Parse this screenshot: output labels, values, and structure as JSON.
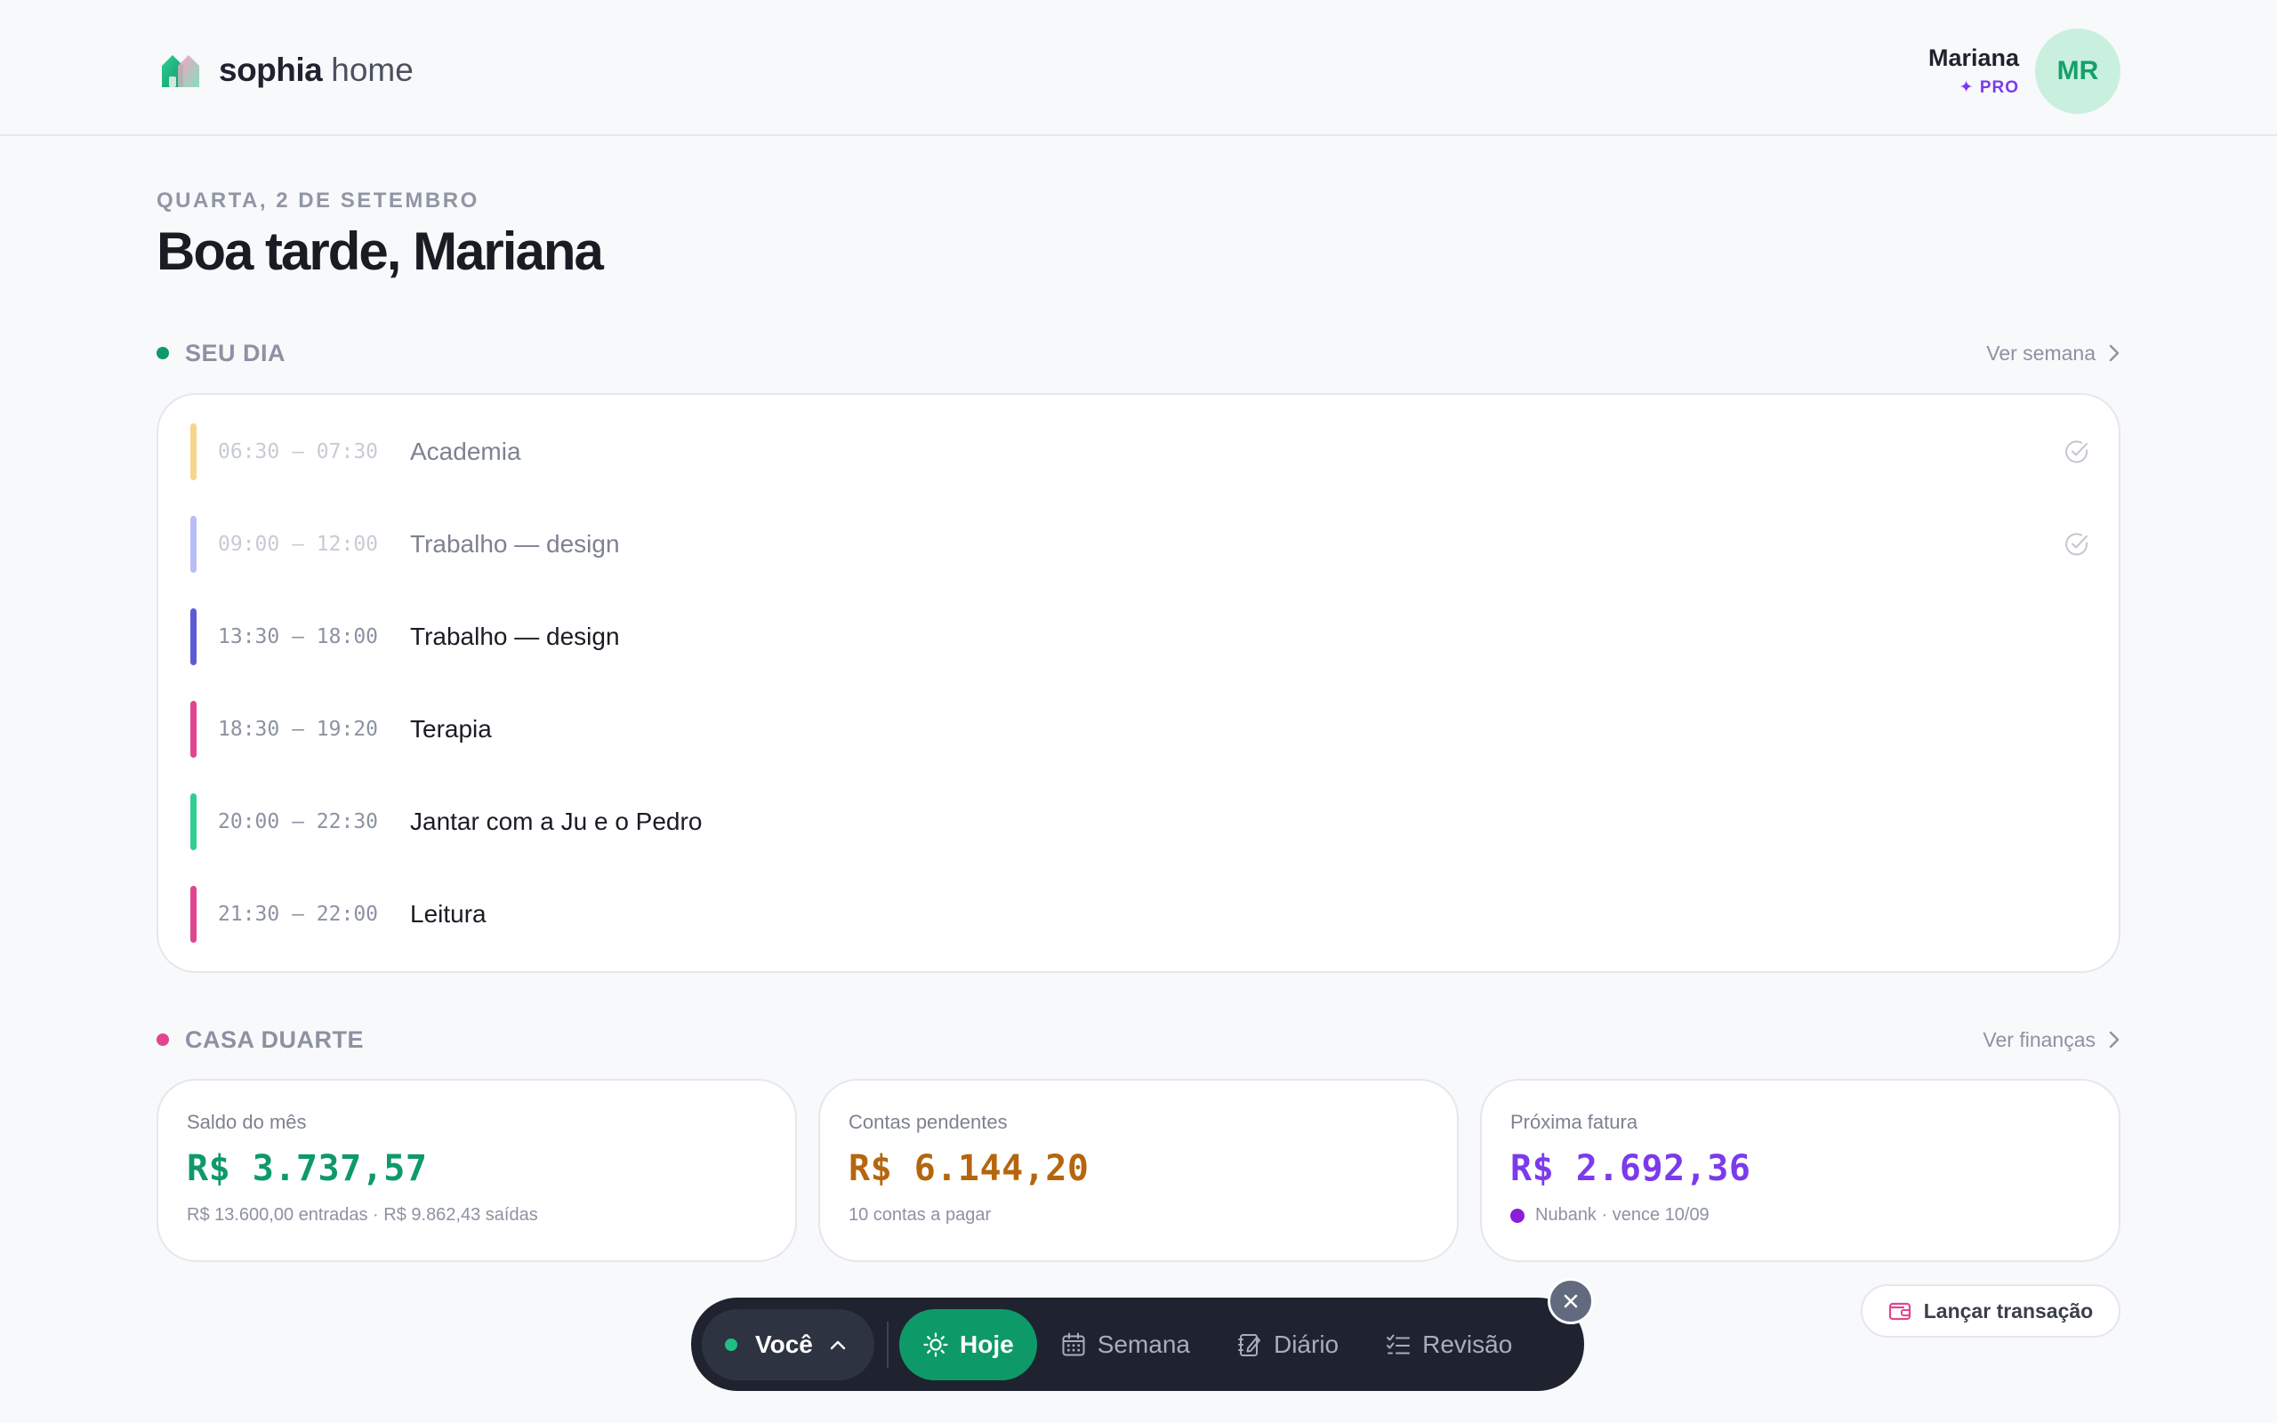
{
  "brand": {
    "name": "sophia",
    "suffix": "home"
  },
  "user": {
    "name": "Mariana",
    "plan": "✦ PRO",
    "initials": "MR"
  },
  "greeting": {
    "date": "QUARTA, 2 DE SETEMBRO",
    "title": "Boa tarde, Mariana"
  },
  "day_section": {
    "title": "SEU DIA",
    "link": "Ver semana",
    "dot_color": "#0e9a68",
    "events": [
      {
        "time": "06:30 – 07:30",
        "title": "Academia",
        "color": "#f7d58a",
        "done": true
      },
      {
        "time": "09:00 – 12:00",
        "title": "Trabalho — design",
        "color": "#b9bdf5",
        "done": true
      },
      {
        "time": "13:30 – 18:00",
        "title": "Trabalho — design",
        "color": "#5b5bd6",
        "done": false
      },
      {
        "time": "18:30 – 19:20",
        "title": "Terapia",
        "color": "#e0468f",
        "done": false
      },
      {
        "time": "20:00 – 22:30",
        "title": "Jantar com a Ju e o Pedro",
        "color": "#2fcf92",
        "done": false
      },
      {
        "time": "21:30 – 22:00",
        "title": "Leitura",
        "color": "#e0468f",
        "done": false
      }
    ]
  },
  "house_section": {
    "title": "CASA DUARTE",
    "link": "Ver finanças",
    "dot_color": "#e0468f",
    "cards": [
      {
        "label": "Saldo do mês",
        "value": "R$ 3.737,57",
        "sub": "R$ 13.600,00 entradas · R$ 9.862,43 saídas",
        "color": "#0e9a68"
      },
      {
        "label": "Contas pendentes",
        "value": "R$ 6.144,20",
        "sub": "10 contas a pagar",
        "color": "#b5660d"
      },
      {
        "label": "Próxima fatura",
        "value": "R$ 2.692,36",
        "sub": "Nubank · vence 10/09",
        "color": "#7c3aed",
        "sub_dot_color": "#8a1fd6"
      }
    ]
  },
  "launch_button": {
    "label": "Lançar transação"
  },
  "dock": {
    "user_label": "Você",
    "items": [
      {
        "label": "Hoje",
        "icon": "sun-icon",
        "active": true
      },
      {
        "label": "Semana",
        "icon": "calendar-icon",
        "active": false
      },
      {
        "label": "Diário",
        "icon": "journal-icon",
        "active": false
      },
      {
        "label": "Revisão",
        "icon": "checklist-icon",
        "active": false
      }
    ]
  }
}
